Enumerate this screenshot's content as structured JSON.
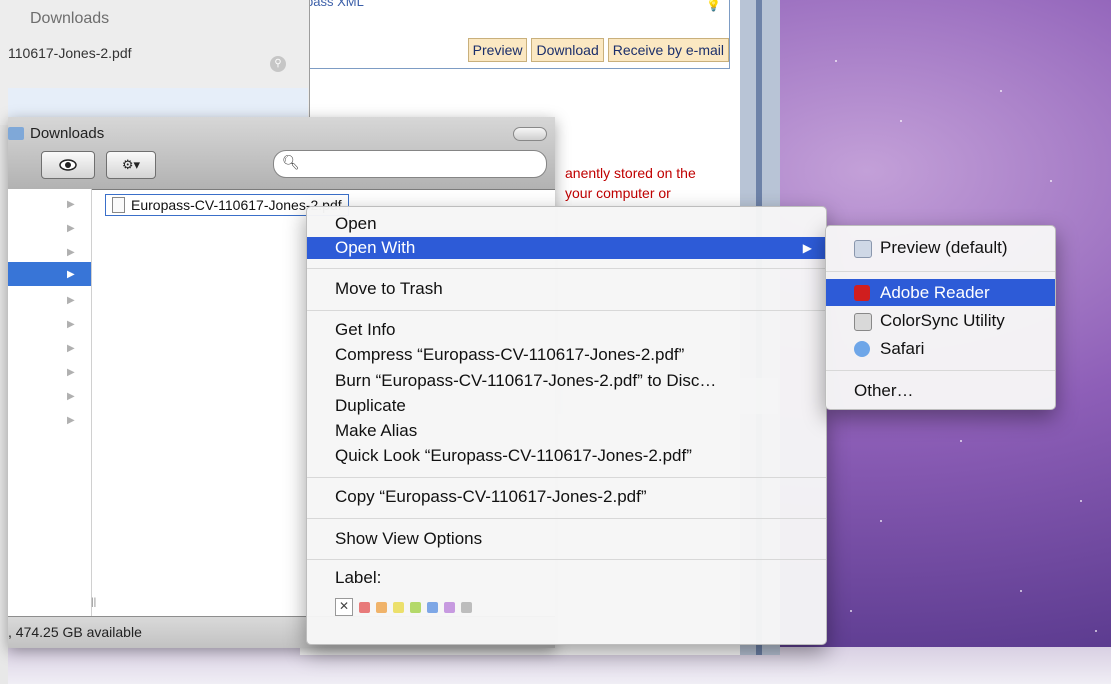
{
  "browser": {
    "xml_text": "pass XML",
    "buttons": [
      "Preview",
      "Download",
      "Receive by e-mail"
    ],
    "red_text_lines": [
      "anently stored on the",
      "your computer or"
    ]
  },
  "back_window": {
    "title": "Downloads",
    "file": "110617-Jones-2.pdf"
  },
  "finder": {
    "title": "Downloads",
    "search_placeholder": "",
    "file_name": "Europass-CV-110617-Jones-2.pdf",
    "status": ", 474.25 GB available"
  },
  "context_menu": {
    "open": "Open",
    "open_with": "Open With",
    "move_to_trash": "Move to Trash",
    "get_info": "Get Info",
    "compress": "Compress “Europass-CV-110617-Jones-2.pdf”",
    "burn": "Burn “Europass-CV-110617-Jones-2.pdf” to Disc…",
    "duplicate": "Duplicate",
    "make_alias": "Make Alias",
    "quick_look": "Quick Look “Europass-CV-110617-Jones-2.pdf”",
    "copy": "Copy “Europass-CV-110617-Jones-2.pdf”",
    "show_view_options": "Show View Options",
    "label": "Label:",
    "label_colors": [
      "#e87a7a",
      "#f0b36a",
      "#ece06c",
      "#b4d96a",
      "#7ea7e6",
      "#c79ae0",
      "#bdbdbd"
    ]
  },
  "submenu": {
    "preview": "Preview (default)",
    "adobe_reader": "Adobe Reader",
    "colorsync": "ColorSync Utility",
    "safari": "Safari",
    "other": "Other…"
  },
  "colors": {
    "highlight": "#2d5bd7",
    "selection": "#3875d7"
  }
}
